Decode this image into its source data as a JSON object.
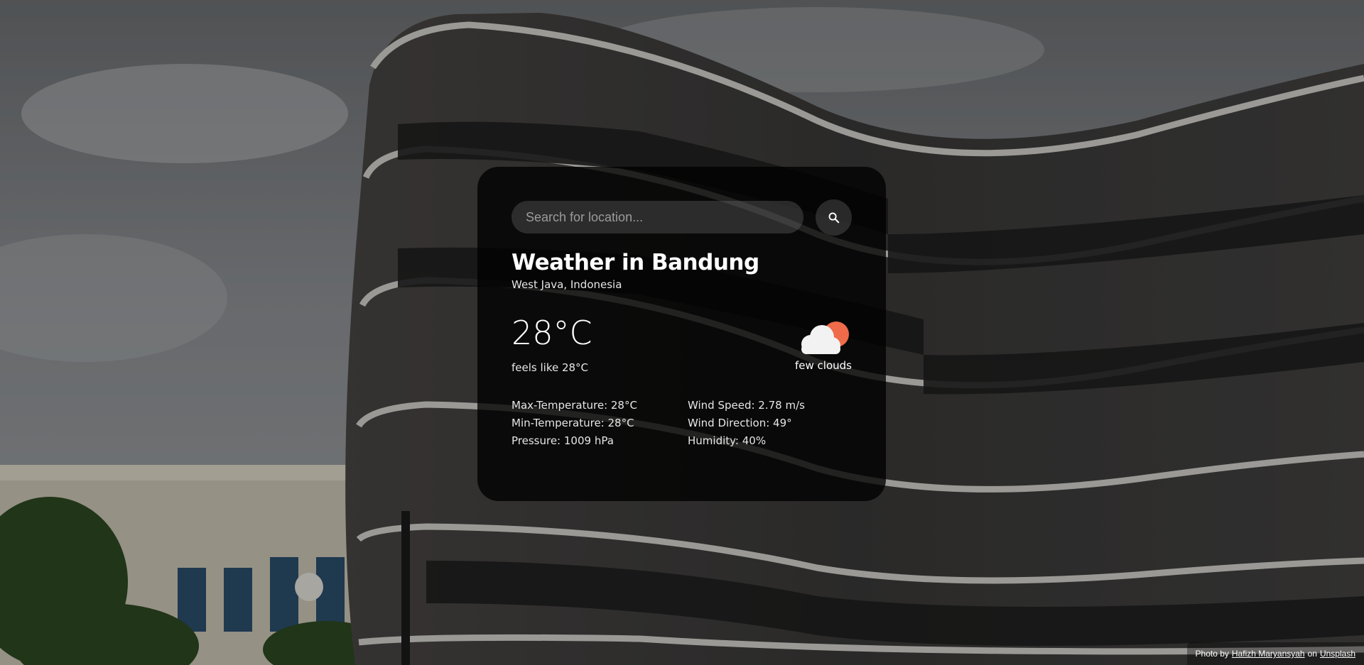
{
  "background": {
    "description_icon": "building-photo",
    "sky_color": "#8d9094",
    "facade_color": "#3d3d3d"
  },
  "search": {
    "placeholder": "Search for location...",
    "value": "",
    "button_icon": "search-icon"
  },
  "weather": {
    "title": "Weather in Bandung",
    "region": "West Java, Indonesia",
    "temperature": "28°C",
    "feels_like": "feels like 28°C",
    "condition": "few clouds",
    "condition_icon": "few-clouds-icon",
    "sun_color": "#ef6b4a",
    "cloud_color": "#f2f2f2",
    "details": {
      "max_temp": "Max-Temperature: 28°C",
      "min_temp": "Min-Temperature: 28°C",
      "pressure": "Pressure: 1009 hPa",
      "wind_speed": "Wind Speed: 2.78 m/s",
      "wind_direction": "Wind Direction: 49°",
      "humidity": "Humidity: 40%"
    }
  },
  "credit": {
    "prefix": "Photo by",
    "author": "Hafizh Maryansyah",
    "joiner": "on",
    "site": "Unsplash"
  }
}
